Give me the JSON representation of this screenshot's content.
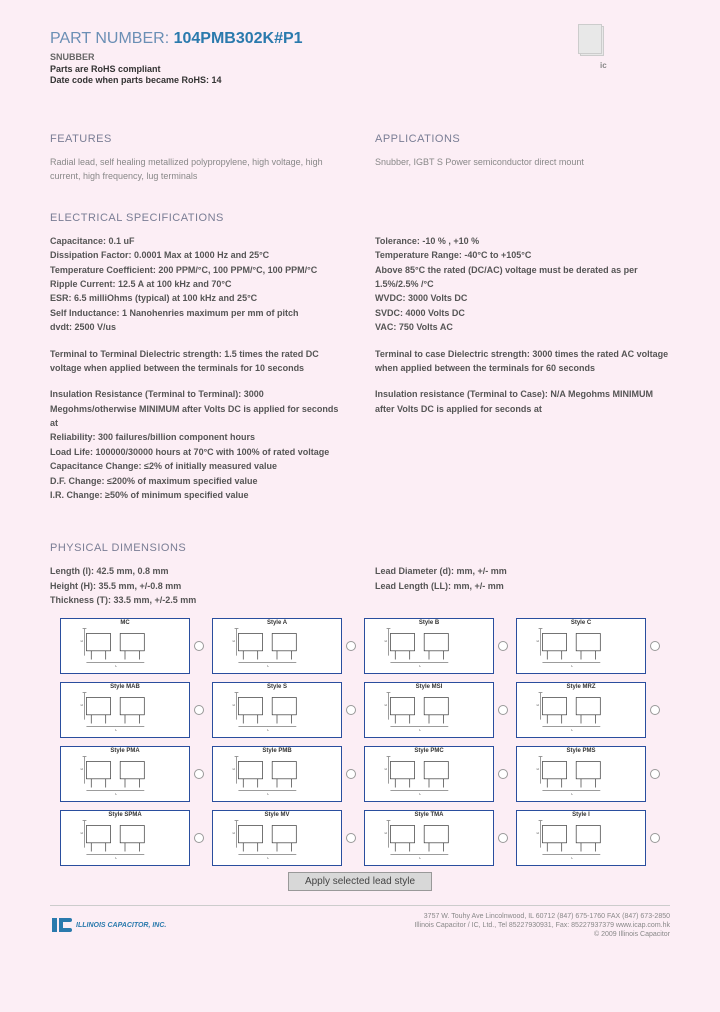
{
  "header": {
    "part_label": "PART NUMBER: ",
    "part_number": "104PMB302K#P1",
    "subtitle": "SNUBBER",
    "rohs": "Parts are RoHS compliant",
    "datecode": "Date code when parts became RoHS: 14",
    "ic_label": "ic"
  },
  "features": {
    "title": "FEATURES",
    "text": "Radial lead, self healing metallized polypropylene, high voltage, high current, high frequency, lug terminals"
  },
  "applications": {
    "title": "APPLICATIONS",
    "text": "Snubber, IGBT S Power semiconductor direct mount"
  },
  "elec": {
    "title": "ELECTRICAL SPECIFICATIONS",
    "left": {
      "cap": "Capacitance: 0.1 uF",
      "diss": "Dissipation Factor: 0.0001 Max at 1000 Hz and 25°C",
      "temp_coef": "Temperature Coefficient: 200 PPM/°C, 100 PPM/°C, 100 PPM/°C",
      "ripple": "Ripple Current: 12.5 A at 100 kHz and 70°C",
      "esr": "ESR: 6.5 milliOhms (typical) at 100 kHz and 25°C",
      "self_ind": "Self Inductance: 1 Nanohenries maximum per mm of pitch",
      "dvdt": "dvdt: 2500 V/us",
      "term_diel": "Terminal to Terminal Dielectric strength: 1.5 times the rated DC voltage when applied between the terminals for 10 seconds",
      "ins_res": "Insulation Resistance (Terminal to Terminal): 3000 Megohms/otherwise MINIMUM after Volts DC is applied for seconds at",
      "reliability": "Reliability: 300 failures/billion component hours",
      "load_life": "Load Life: 100000/30000 hours at 70°C with 100% of rated voltage",
      "cap_change": "Capacitance Change: ≤2% of initially measured value",
      "df_change": "D.F. Change: ≤200% of maximum specified value",
      "ir_change": "I.R. Change: ≥50% of minimum specified value"
    },
    "right": {
      "tol": "Tolerance: -10 % , +10 %",
      "temp_range": "Temperature Range: -40°C to +105°C",
      "above": "Above 85°C the rated (DC/AC) voltage must be derated as per 1.5%/2.5% /°C",
      "wvdc": "WVDC: 3000 Volts DC",
      "svdc": "SVDC: 4000 Volts DC",
      "vac": "VAC: 750 Volts AC",
      "term_case": "Terminal to case Dielectric strength: 3000 times the rated AC voltage when applied between the terminals for 60 seconds",
      "ins_case": "Insulation resistance (Terminal to Case): N/A Megohms MINIMUM after Volts DC is applied for seconds at"
    }
  },
  "phys": {
    "title": "PHYSICAL DIMENSIONS",
    "left": {
      "length": "Length (l): 42.5 mm, 0.8 mm",
      "height": "Height (H): 35.5 mm, +/-0.8 mm",
      "thickness": "Thickness (T): 33.5 mm, +/-2.5 mm"
    },
    "right": {
      "lead_diam": "Lead Diameter (d): mm, +/- mm",
      "lead_len": "Lead Length (LL): mm, +/- mm"
    }
  },
  "diagrams": [
    {
      "title": "MC",
      "footer": ""
    },
    {
      "title": "Style A",
      "footer": ""
    },
    {
      "title": "Style B",
      "footer": ""
    },
    {
      "title": "Style C",
      "footer": ""
    },
    {
      "title": "Style MAB",
      "footer": ""
    },
    {
      "title": "Style S",
      "footer": ""
    },
    {
      "title": "Style MSI",
      "footer": ""
    },
    {
      "title": "Style MRZ",
      "footer": ""
    },
    {
      "title": "Style PMA",
      "footer": ""
    },
    {
      "title": "Style PMB",
      "footer": ""
    },
    {
      "title": "Style PMC",
      "footer": ""
    },
    {
      "title": "Style PMS",
      "footer": ""
    },
    {
      "title": "Style SPMA",
      "footer": ""
    },
    {
      "title": "Style MV",
      "footer": ""
    },
    {
      "title": "Style TMA",
      "footer": ""
    },
    {
      "title": "Style I",
      "footer": ""
    }
  ],
  "apply_btn": "Apply selected lead style",
  "footer": {
    "company": "ILLINOIS CAPACITOR, INC.",
    "addr": "3757 W. Touhy Ave    Lincolnwood, IL 60712   (847) 675-1760   FAX (847) 673-2850",
    "intl": "Illinois Capacitor / IC, Ltd., Tel 85227930931, Fax: 85227937379    www.icap.com.hk",
    "copy": "© 2009 Illinois Capacitor"
  }
}
